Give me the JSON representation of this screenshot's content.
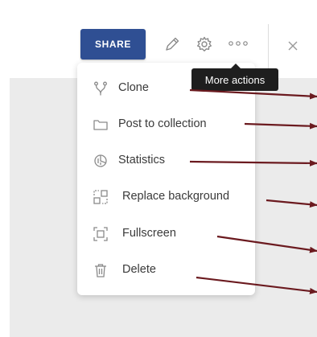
{
  "toolbar": {
    "share_label": "SHARE",
    "tooltip": "More actions",
    "icons": [
      "pencil-icon",
      "gear-icon",
      "more-dots-icon",
      "close-icon"
    ]
  },
  "menu": {
    "items": [
      {
        "label": "Clone",
        "icon": "clone-icon"
      },
      {
        "label": "Post to collection",
        "icon": "folder-icon"
      },
      {
        "label": "Statistics",
        "icon": "statistics-icon"
      },
      {
        "label": "Replace background",
        "icon": "replace-background-icon"
      },
      {
        "label": "Fullscreen",
        "icon": "fullscreen-icon"
      },
      {
        "label": "Delete",
        "icon": "trash-icon"
      }
    ]
  },
  "colors": {
    "share_button": "#2f4f93",
    "tooltip_bg": "#1e1e1e",
    "annotation_arrow": "#6b1a1f",
    "canvas_bg": "#ebebeb"
  }
}
